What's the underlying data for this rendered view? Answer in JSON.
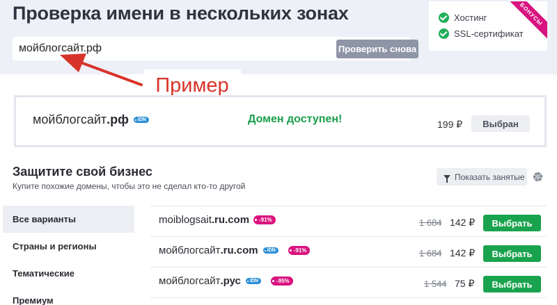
{
  "header": {
    "title": "Проверка имени в нескольких зонах",
    "search_value": "мойблогсайт.рф",
    "recheck_label": "Проверить снова"
  },
  "bonuses": {
    "ribbon": "БОНУСЫ",
    "items": [
      {
        "label": "Хостинг",
        "icon": "check-circle-icon"
      },
      {
        "label": "SSL-сертификат",
        "icon": "check-circle-icon"
      }
    ]
  },
  "annotation": {
    "label": "Пример",
    "color": "#d8332a"
  },
  "result": {
    "domain_name": "мойблогсайт",
    "domain_zone": ".рф",
    "idn_badge": "IDN",
    "status": "Домен доступен!",
    "price": "199 ₽",
    "button_label": "Выбран"
  },
  "protect": {
    "title": "Защитите свой бизнес",
    "subtitle": "Купите похожие домены, чтобы это не сделал кто-то другой",
    "filter_label": "Показать занятые"
  },
  "sidebar": {
    "items": [
      {
        "label": "Все варианты",
        "active": true
      },
      {
        "label": "Страны и регионы",
        "active": false
      },
      {
        "label": "Тематические",
        "active": false
      },
      {
        "label": "Премиум",
        "active": false
      }
    ]
  },
  "suggestions": [
    {
      "name": "moiblogsait",
      "zone": ".ru.com",
      "idn": "",
      "discount": "-91%",
      "old_price": "1 684",
      "price": "142 ₽",
      "button": "Выбрать"
    },
    {
      "name": "мойблогсайт",
      "zone": ".ru.com",
      "idn": "IDN",
      "discount": "-91%",
      "old_price": "1 684",
      "price": "142 ₽",
      "button": "Выбрать"
    },
    {
      "name": "мойблогсайт",
      "zone": ".рус",
      "idn": "IDN",
      "discount": "-95%",
      "old_price": "1 544",
      "price": "75 ₽",
      "button": "Выбрать"
    }
  ],
  "colors": {
    "accent_green": "#1aa34e",
    "status_green": "#1a9e4b",
    "discount_magenta": "#d9137f",
    "idn_blue": "#2d8fd6"
  }
}
